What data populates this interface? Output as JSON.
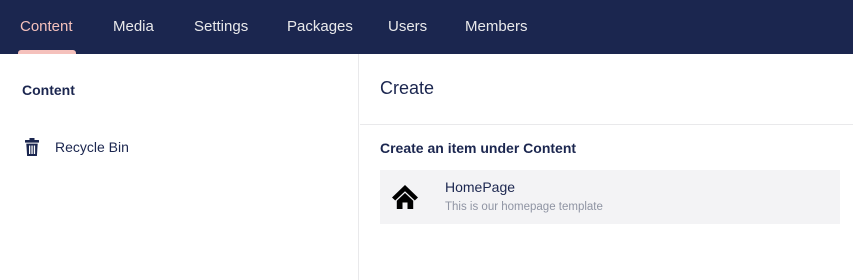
{
  "nav": {
    "items": [
      {
        "label": "Content",
        "active": true
      },
      {
        "label": "Media",
        "active": false
      },
      {
        "label": "Settings",
        "active": false
      },
      {
        "label": "Packages",
        "active": false
      },
      {
        "label": "Users",
        "active": false
      },
      {
        "label": "Members",
        "active": false
      }
    ],
    "active_color": "#f5c1bc",
    "background": "#1b264f"
  },
  "sidebar": {
    "root_label": "Content",
    "items": [
      {
        "label": "Recycle Bin",
        "icon": "trash-icon"
      }
    ]
  },
  "panel": {
    "title": "Create",
    "subheading": "Create an item under Content",
    "doctypes": [
      {
        "name": "HomePage",
        "description": "This is our homepage template",
        "icon": "home-icon"
      }
    ]
  }
}
